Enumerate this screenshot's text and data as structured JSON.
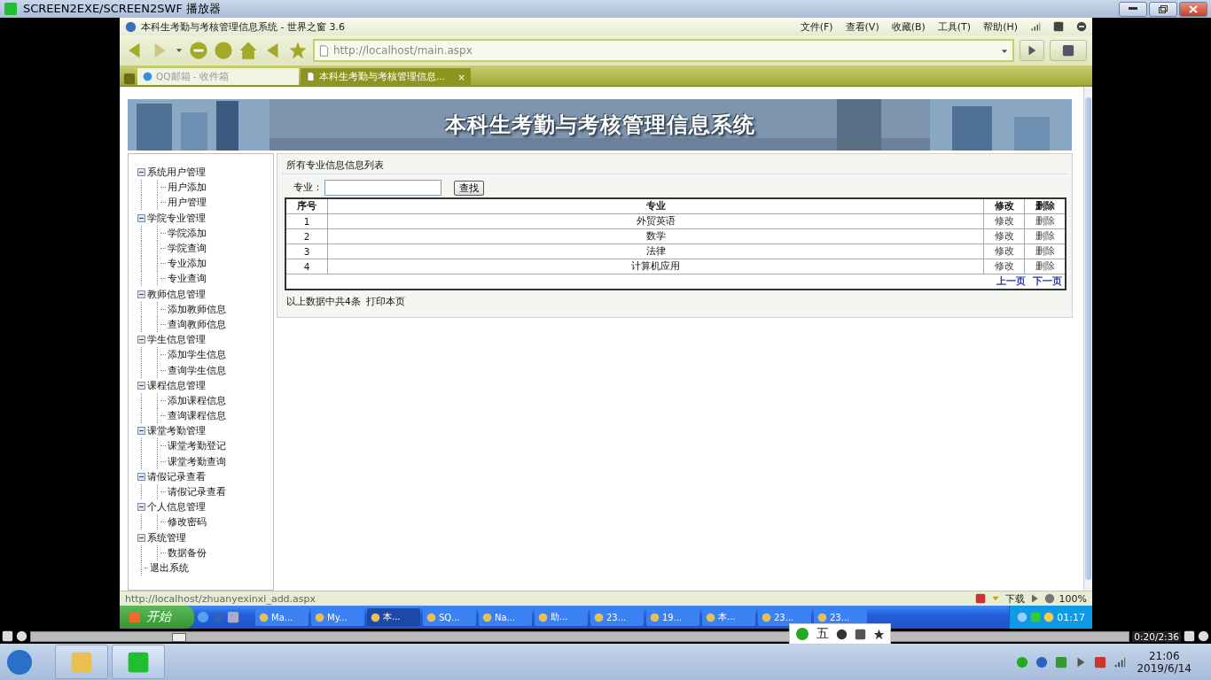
{
  "player": {
    "title": "SCREEN2EXE/SCREEN2SWF 播放器",
    "seek": {
      "level": 0.128
    },
    "time": "0:20/2:36"
  },
  "browser": {
    "title": "本科生考勤与考核管理信息系统 - 世界之窗 3.6",
    "menu": [
      "文件(F)",
      "查看(V)",
      "收藏(B)",
      "工具(T)",
      "帮助(H)"
    ],
    "address": "http://localhost/main.aspx",
    "tabs": [
      {
        "label": "QQ邮箱 - 收件箱",
        "selected": false
      },
      {
        "label": "本科生考勤与考核管理信息...",
        "selected": true,
        "close": "×"
      }
    ],
    "status": {
      "url": "http://localhost/zhuanyexinxi_add.aspx",
      "download": "下载",
      "zoom": "100%"
    }
  },
  "page": {
    "banner_title": "本科生考勤与考核管理信息系统",
    "sidebar": [
      {
        "label": "系统用户管理",
        "expanded": true,
        "children": [
          {
            "label": "用户添加"
          },
          {
            "label": "用户管理"
          }
        ]
      },
      {
        "label": "学院专业管理",
        "expanded": true,
        "children": [
          {
            "label": "学院添加"
          },
          {
            "label": "学院查询"
          },
          {
            "label": "专业添加"
          },
          {
            "label": "专业查询"
          }
        ]
      },
      {
        "label": "教师信息管理",
        "expanded": true,
        "children": [
          {
            "label": "添加教师信息"
          },
          {
            "label": "查询教师信息"
          }
        ]
      },
      {
        "label": "学生信息管理",
        "expanded": true,
        "children": [
          {
            "label": "添加学生信息"
          },
          {
            "label": "查询学生信息"
          }
        ]
      },
      {
        "label": "课程信息管理",
        "expanded": true,
        "children": [
          {
            "label": "添加课程信息"
          },
          {
            "label": "查询课程信息"
          }
        ]
      },
      {
        "label": "课堂考勤管理",
        "expanded": true,
        "children": [
          {
            "label": "课堂考勤登记"
          },
          {
            "label": "课堂考勤查询"
          }
        ]
      },
      {
        "label": "请假记录查看",
        "expanded": true,
        "children": [
          {
            "label": "请假记录查看"
          }
        ]
      },
      {
        "label": "个人信息管理",
        "expanded": true,
        "children": [
          {
            "label": "修改密码"
          }
        ]
      },
      {
        "label": "系统管理",
        "expanded": true,
        "children": [
          {
            "label": "数据备份"
          }
        ]
      },
      {
        "label": "退出系统"
      }
    ],
    "panel_title": "所有专业信息信息列表",
    "search": {
      "label": "专业：",
      "button": "查找"
    },
    "table": {
      "columns": [
        "序号",
        "专业",
        "修改",
        "删除"
      ],
      "rows": [
        {
          "no": "1",
          "major": "外贸英语",
          "edit": "修改",
          "delete": "删除"
        },
        {
          "no": "2",
          "major": "数学",
          "edit": "修改",
          "delete": "删除"
        },
        {
          "no": "3",
          "major": "法律",
          "edit": "修改",
          "delete": "删除"
        },
        {
          "no": "4",
          "major": "计算机应用",
          "edit": "修改",
          "delete": "删除"
        }
      ]
    },
    "pager": [
      "上一页",
      "下一页"
    ],
    "summary": "以上数据中共4条",
    "print": "打印本页"
  },
  "xp_taskbar": {
    "start": "开始",
    "tasks": [
      {
        "label": "Ma...",
        "selected": false
      },
      {
        "label": "My...",
        "selected": false
      },
      {
        "label": "本...",
        "selected": true
      },
      {
        "label": "SQ...",
        "selected": false
      },
      {
        "label": "Na...",
        "selected": false
      },
      {
        "label": "助...",
        "selected": false
      },
      {
        "label": "23...",
        "selected": false
      },
      {
        "label": "19...",
        "selected": false
      },
      {
        "label": "本...",
        "selected": false
      },
      {
        "label": "23...",
        "selected": false
      },
      {
        "label": "23...",
        "selected": false
      }
    ],
    "clock": "01:17"
  },
  "ime": {
    "mode": "五"
  },
  "win_taskbar": {
    "time": "21:06",
    "date": "2019/6/14"
  }
}
